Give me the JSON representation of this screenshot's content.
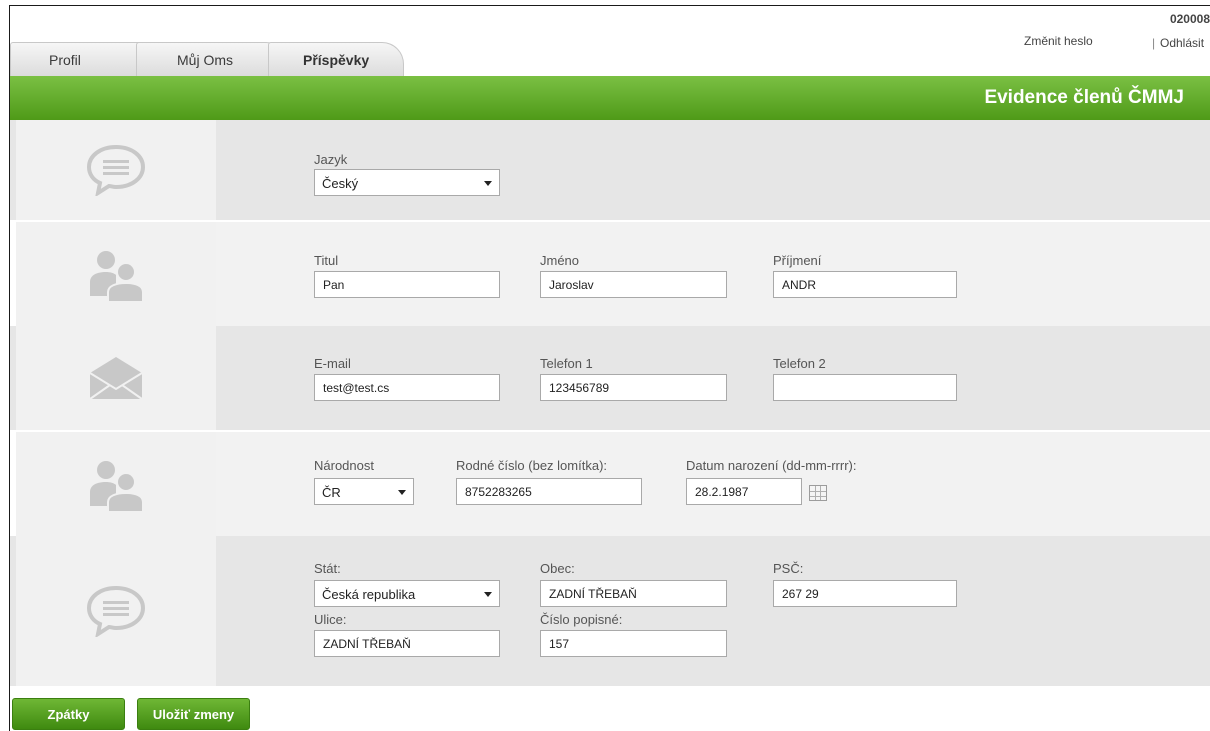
{
  "header": {
    "user_number": "020008",
    "change_password": "Změnit heslo",
    "separator": "|",
    "logout": "Odhlásit"
  },
  "tabs": [
    {
      "label": "Profil"
    },
    {
      "label": "Můj Oms"
    },
    {
      "label": "Příspěvky"
    }
  ],
  "banner": {
    "title": "Evidence členů ČMMJ"
  },
  "language": {
    "label": "Jazyk",
    "value": "Český"
  },
  "name": {
    "title_label": "Titul",
    "title_value": "Pan",
    "first_label": "Jméno",
    "first_value": "Jaroslav",
    "last_label": "Příjmení",
    "last_value": "ANDR"
  },
  "contact": {
    "email_label": "E-mail",
    "email_value": "test@test.cs",
    "phone1_label": "Telefon 1",
    "phone1_value": "123456789",
    "phone2_label": "Telefon 2",
    "phone2_value": ""
  },
  "identity": {
    "nationality_label": "Národnost",
    "nationality_value": "ČR",
    "birth_number_label": "Rodné číslo (bez lomítka):",
    "birth_number_value": "8752283265",
    "birth_date_label": "Datum narození (dd-mm-rrrr):",
    "birth_date_value": "28.2.1987"
  },
  "address": {
    "state_label": "Stát:",
    "state_value": "Česká republika",
    "city_label": "Obec:",
    "city_value": "ZADNÍ TŘEBAŇ",
    "zip_label": "PSČ:",
    "zip_value": "267 29",
    "street_label": "Ulice:",
    "street_value": "ZADNÍ TŘEBAŇ",
    "house_label": "Číslo popisné:",
    "house_value": "157"
  },
  "buttons": {
    "back": "Zpátky",
    "save": "Uložiť zmeny"
  },
  "colors": {
    "accent_green": "#5aa620",
    "icon_gray": "#c8c8c8"
  }
}
